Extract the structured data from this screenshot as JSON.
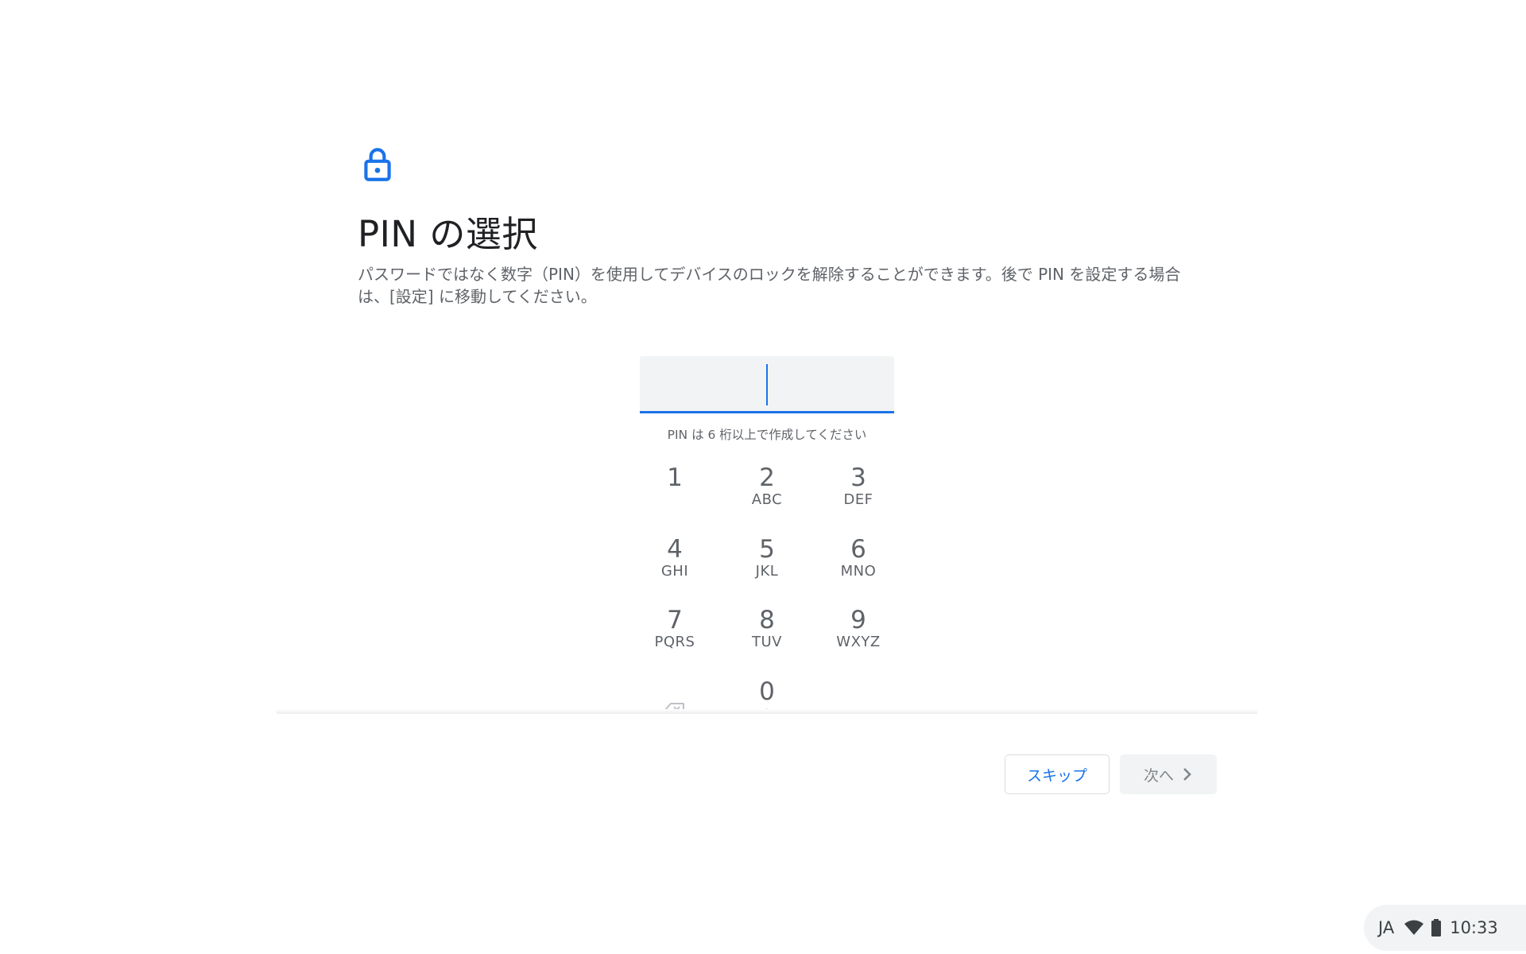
{
  "header": {
    "icon": "lock-icon",
    "title": "PIN の選択",
    "description": "パスワードではなく数字（PIN）を使用してデバイスのロックを解除することができます。後で PIN を設定する場合は、[設定] に移動してください。"
  },
  "pin": {
    "value": "",
    "hint": "PIN は 6 桁以上で作成してください"
  },
  "keypad": {
    "keys": [
      {
        "digit": "1",
        "letters": ""
      },
      {
        "digit": "2",
        "letters": "ABC"
      },
      {
        "digit": "3",
        "letters": "DEF"
      },
      {
        "digit": "4",
        "letters": "GHI"
      },
      {
        "digit": "5",
        "letters": "JKL"
      },
      {
        "digit": "6",
        "letters": "MNO"
      },
      {
        "digit": "7",
        "letters": "PQRS"
      },
      {
        "digit": "8",
        "letters": "TUV"
      },
      {
        "digit": "9",
        "letters": "WXYZ"
      },
      {
        "digit": "0",
        "letters": "+"
      }
    ],
    "backspace_icon": "backspace-icon"
  },
  "buttons": {
    "skip_label": "スキップ",
    "next_label": "次へ",
    "next_icon": "chevron-right-icon"
  },
  "tray": {
    "ime": "JA",
    "wifi_icon": "wifi-icon",
    "battery_icon": "battery-icon",
    "time": "10:33"
  },
  "colors": {
    "accent": "#1a73e8",
    "field_bg": "#f1f3f4",
    "secondary_text": "#5f6368"
  }
}
